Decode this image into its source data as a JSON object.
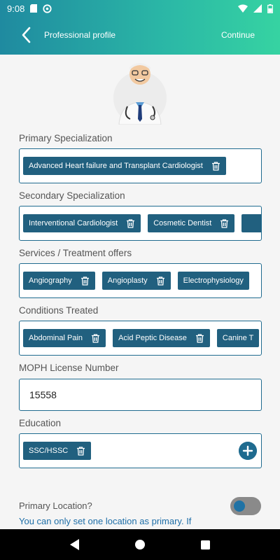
{
  "status_bar": {
    "time": "9:08",
    "icons": [
      "sd-card-icon",
      "sync-icon",
      "wifi-icon",
      "signal-icon",
      "battery-icon"
    ]
  },
  "header": {
    "title": "Professional profile",
    "action": "Continue"
  },
  "sections": {
    "primary": {
      "label": "Primary Specialization",
      "chips": [
        "Advanced Heart failure and Transplant Cardiologist"
      ]
    },
    "secondary": {
      "label": "Secondary Specialization",
      "chips": [
        "Interventional Cardiologist",
        "Cosmetic Dentist"
      ]
    },
    "services": {
      "label": "Services / Treatment offers",
      "chips": [
        "Angiography",
        "Angioplasty",
        "Electrophysiology"
      ]
    },
    "conditions": {
      "label": "Conditions Treated",
      "chips": [
        "Abdominal Pain",
        "Acid Peptic Disease",
        "Canine T"
      ]
    },
    "license": {
      "label": "MOPH License Number",
      "value": "15558"
    },
    "education": {
      "label": "Education",
      "chips": [
        "SSC/HSSC"
      ]
    }
  },
  "primary_location": {
    "label": "Primary Location?",
    "note": "You can only set one location as primary. If",
    "toggle_on": true
  },
  "colors": {
    "header_start": "#1f8aa0",
    "header_end": "#36d3a2",
    "chip": "#21607f",
    "border": "#1f6b8f",
    "note": "#1f6fa8"
  }
}
